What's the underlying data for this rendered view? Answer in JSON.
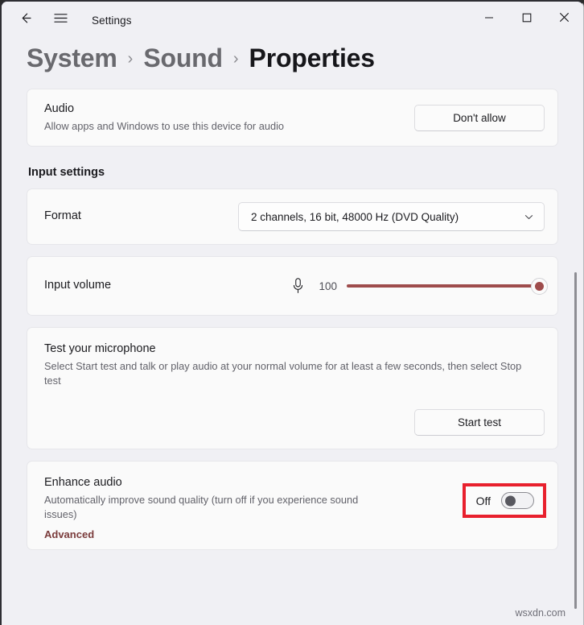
{
  "window": {
    "title": "Settings",
    "back_icon": "back-arrow-icon",
    "menu_icon": "hamburger-menu-icon",
    "minimize_icon": "minimize-icon",
    "maximize_icon": "maximize-icon",
    "close_icon": "close-icon"
  },
  "breadcrumb": {
    "items": [
      {
        "label": "System"
      },
      {
        "label": "Sound"
      },
      {
        "label": "Properties"
      }
    ],
    "separator": "›"
  },
  "audio_card": {
    "title": "Audio",
    "description": "Allow apps and Windows to use this device for audio",
    "button_label": "Don't allow"
  },
  "input_settings": {
    "section_title": "Input settings",
    "format": {
      "label": "Format",
      "value": "2 channels, 16 bit, 48000 Hz (DVD Quality)",
      "chevron_icon": "chevron-down-icon"
    },
    "input_volume": {
      "label": "Input volume",
      "mic_icon": "microphone-icon",
      "value": "100",
      "min": 0,
      "max": 100,
      "accent_color": "#9e4c4c"
    },
    "test_microphone": {
      "title": "Test your microphone",
      "description": "Select Start test and talk or play audio at your normal volume for at least a few seconds, then select Stop test",
      "button_label": "Start test"
    },
    "enhance_audio": {
      "title": "Enhance audio",
      "description": "Automatically improve sound quality (turn off if you experience sound issues)",
      "link_label": "Advanced",
      "toggle_state_label": "Off",
      "toggle_on": false,
      "highlight_color": "#e8202d"
    }
  },
  "watermark": "wsxdn.com"
}
